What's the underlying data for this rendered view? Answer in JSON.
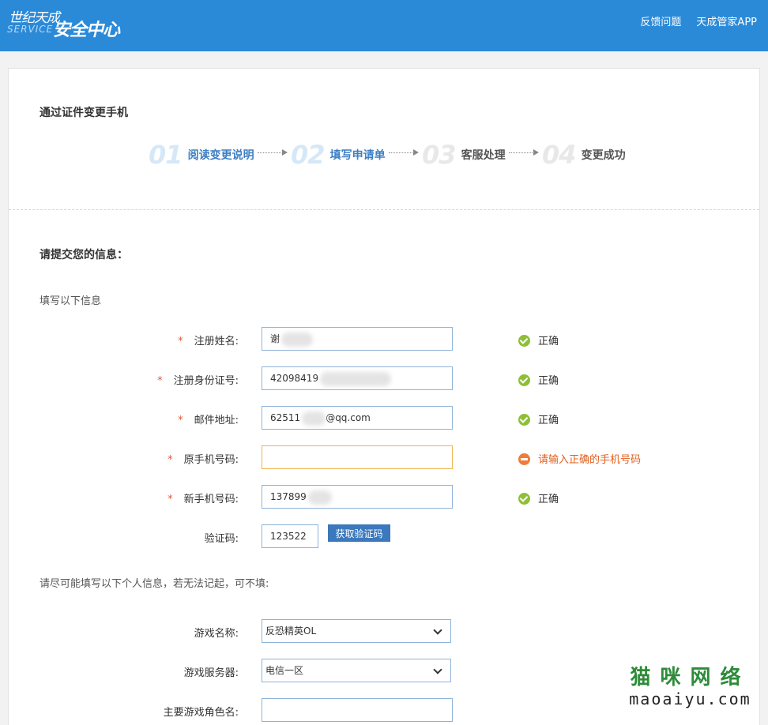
{
  "header": {
    "logo_top": "世纪天成",
    "logo_service": "SERVICE",
    "logo_main": "安全中心",
    "links": [
      "反馈问题",
      "天成管家APP"
    ]
  },
  "page_title": "通过证件变更手机",
  "steps": [
    {
      "num": "01",
      "label": "阅读变更说明",
      "state": "done"
    },
    {
      "num": "02",
      "label": "填写申请单",
      "state": "active"
    },
    {
      "num": "03",
      "label": "客服处理",
      "state": "pending"
    },
    {
      "num": "04",
      "label": "变更成功",
      "state": "pending"
    }
  ],
  "section_title": "请提交您的信息：",
  "section_sub": "填写以下信息",
  "fields": {
    "name": {
      "label": "注册姓名:",
      "value": "谢",
      "status": "正确"
    },
    "id": {
      "label": "注册身份证号:",
      "value": "42098419",
      "status": "正确"
    },
    "email": {
      "label": "邮件地址:",
      "value_pre": "62511",
      "value_post": "@qq.com",
      "status": "正确"
    },
    "old_phone": {
      "label": "原手机号码:",
      "value": "",
      "status": "请输入正确的手机号码"
    },
    "new_phone": {
      "label": "新手机号码:",
      "value": "137899",
      "status": "正确"
    },
    "captcha": {
      "label": "验证码:",
      "value": "123522",
      "button": "获取验证码"
    }
  },
  "optional_note": "请尽可能填写以下个人信息，若无法记起，可不填:",
  "optional": {
    "game_name": {
      "label": "游戏名称:",
      "selected": "反恐精英OL"
    },
    "game_server": {
      "label": "游戏服务器:",
      "selected": "电信一区"
    },
    "role_name": {
      "label": "主要游戏角色名:",
      "value": ""
    }
  },
  "watermark": {
    "cn": "猫咪网络",
    "en": "maoaiyu.com"
  },
  "colors": {
    "header_bg": "#2b8ad8",
    "ok": "#8dbf37",
    "error": "#f07b3a",
    "button": "#3b78bd"
  }
}
